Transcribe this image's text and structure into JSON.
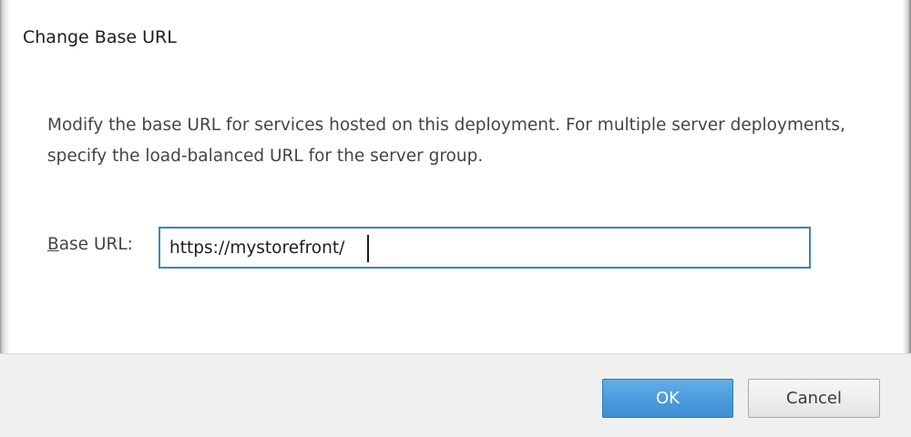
{
  "dialog": {
    "title": "Change Base URL",
    "description": "Modify the base URL for services hosted on this deployment. For multiple server deployments, specify the load-balanced URL for the server group.",
    "base_url": {
      "label_mnemonic": "B",
      "label_rest": "ase URL:",
      "value": "https://mystorefront/"
    },
    "buttons": {
      "ok_label": "OK",
      "cancel_label": "Cancel"
    }
  },
  "colors": {
    "primary_button": "#4a9bdc",
    "input_focus_border": "#3c82c8",
    "footer_background": "#f0f0f0"
  }
}
